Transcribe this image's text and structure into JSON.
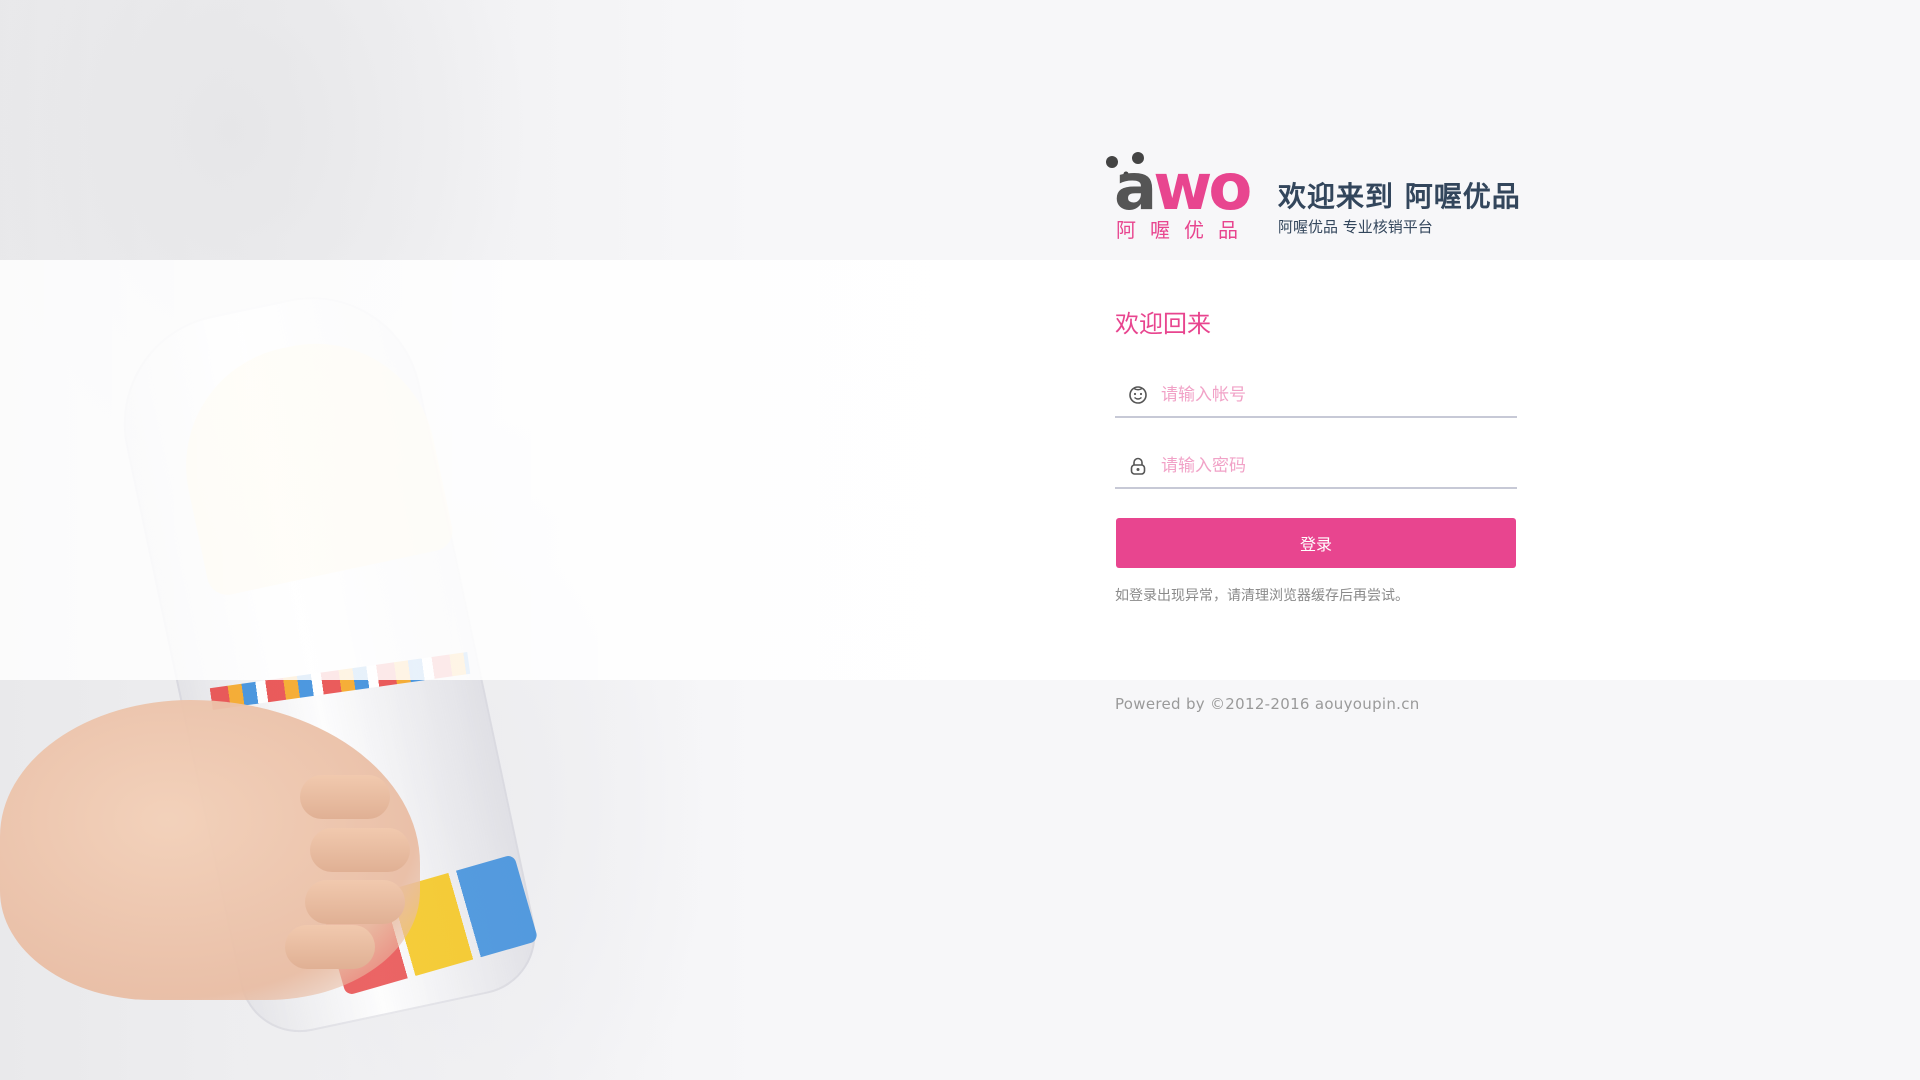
{
  "brand": {
    "logo_latin_a": "a",
    "logo_latin_wo": "wo",
    "logo_chinese": "阿喔优品",
    "accent_color": "#e8458f",
    "title_color": "#33465c"
  },
  "header": {
    "title": "欢迎来到 阿喔优品",
    "subtitle": "阿喔优品 专业核销平台"
  },
  "form": {
    "welcome": "欢迎回来",
    "username": {
      "value": "",
      "placeholder": "请输入帐号",
      "icon": "user-face-icon"
    },
    "password": {
      "value": "",
      "placeholder": "请输入密码",
      "icon": "lock-icon"
    },
    "login_label": "登录",
    "hint": "如登录出现异常，请清理浏览器缓存后再尝试。"
  },
  "footer": {
    "text": "Powered by ©2012-2016 aouyoupin.cn"
  }
}
